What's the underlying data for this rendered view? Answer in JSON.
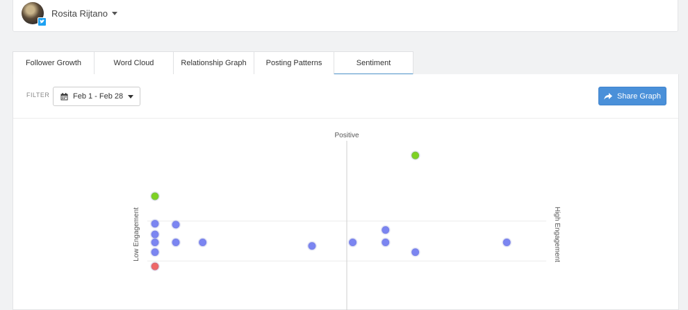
{
  "profile": {
    "name": "Rosita Rijtano",
    "network_badge": "twitter-icon"
  },
  "tabs": [
    {
      "label": "Follower Growth",
      "active": false
    },
    {
      "label": "Word Cloud",
      "active": false
    },
    {
      "label": "Relationship Graph",
      "active": false
    },
    {
      "label": "Posting Patterns",
      "active": false
    },
    {
      "label": "Sentiment",
      "active": true
    }
  ],
  "filter": {
    "label": "FILTER",
    "date_range": "Feb 1 - Feb 28"
  },
  "share": {
    "label": "Share Graph"
  },
  "colors": {
    "accent": "#4a90d9",
    "neutral_point": "#7b85f2",
    "positive_point": "#7ed321",
    "negative_point": "#f06666"
  },
  "chart_data": {
    "type": "scatter",
    "labels": {
      "top": "Positive",
      "left": "Low Engagement",
      "right": "High Engagement"
    },
    "xlim": [
      -1,
      1
    ],
    "ylim": [
      -1,
      1
    ],
    "grid_lines_y": [
      0.15,
      -0.3
    ],
    "points": [
      {
        "x": 0.345,
        "y": 0.89,
        "sentiment": "positive"
      },
      {
        "x": -0.965,
        "y": 0.43,
        "sentiment": "positive"
      },
      {
        "x": -0.965,
        "y": 0.12,
        "sentiment": "neutral"
      },
      {
        "x": -0.86,
        "y": 0.11,
        "sentiment": "neutral"
      },
      {
        "x": -0.965,
        "y": 0.0,
        "sentiment": "neutral"
      },
      {
        "x": -0.965,
        "y": -0.09,
        "sentiment": "neutral"
      },
      {
        "x": -0.86,
        "y": -0.09,
        "sentiment": "neutral"
      },
      {
        "x": -0.725,
        "y": -0.09,
        "sentiment": "neutral"
      },
      {
        "x": -0.965,
        "y": -0.2,
        "sentiment": "neutral"
      },
      {
        "x": -0.175,
        "y": -0.13,
        "sentiment": "neutral"
      },
      {
        "x": 0.03,
        "y": -0.09,
        "sentiment": "neutral"
      },
      {
        "x": 0.195,
        "y": 0.05,
        "sentiment": "neutral"
      },
      {
        "x": 0.195,
        "y": -0.09,
        "sentiment": "neutral"
      },
      {
        "x": 0.345,
        "y": -0.2,
        "sentiment": "neutral"
      },
      {
        "x": 0.805,
        "y": -0.09,
        "sentiment": "neutral"
      },
      {
        "x": -0.965,
        "y": -0.36,
        "sentiment": "negative"
      }
    ]
  }
}
